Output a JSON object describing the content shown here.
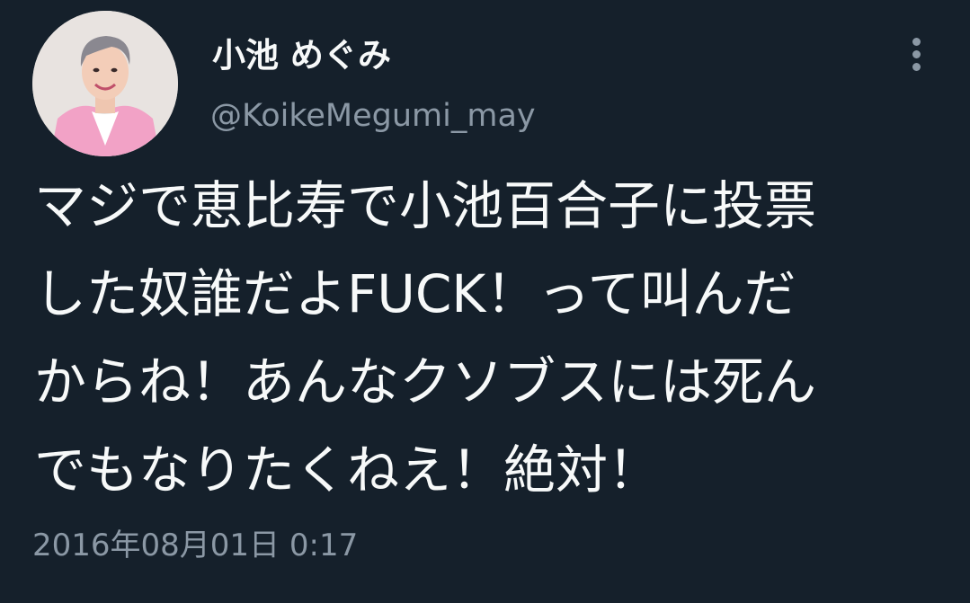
{
  "author": {
    "display_name": "小池 めぐみ",
    "handle": "@KoikeMegumi_may",
    "avatar_icon": "profile-photo"
  },
  "tweet": {
    "lines": [
      "マジで恵比寿で小池百合子に投票",
      "した奴誰だよFUCK！って叫んだ",
      "からね！あんなクソブスには死ん",
      "でもなりたくねえ！絶対！"
    ],
    "timestamp": "2016年08月01日 0:17"
  },
  "icons": {
    "more": "more-vertical-icon"
  },
  "colors": {
    "background": "#15202b",
    "primary_text": "#f7f9f9",
    "secondary_text": "#8b98a5",
    "jacket_pink": "#f2a2c6"
  }
}
